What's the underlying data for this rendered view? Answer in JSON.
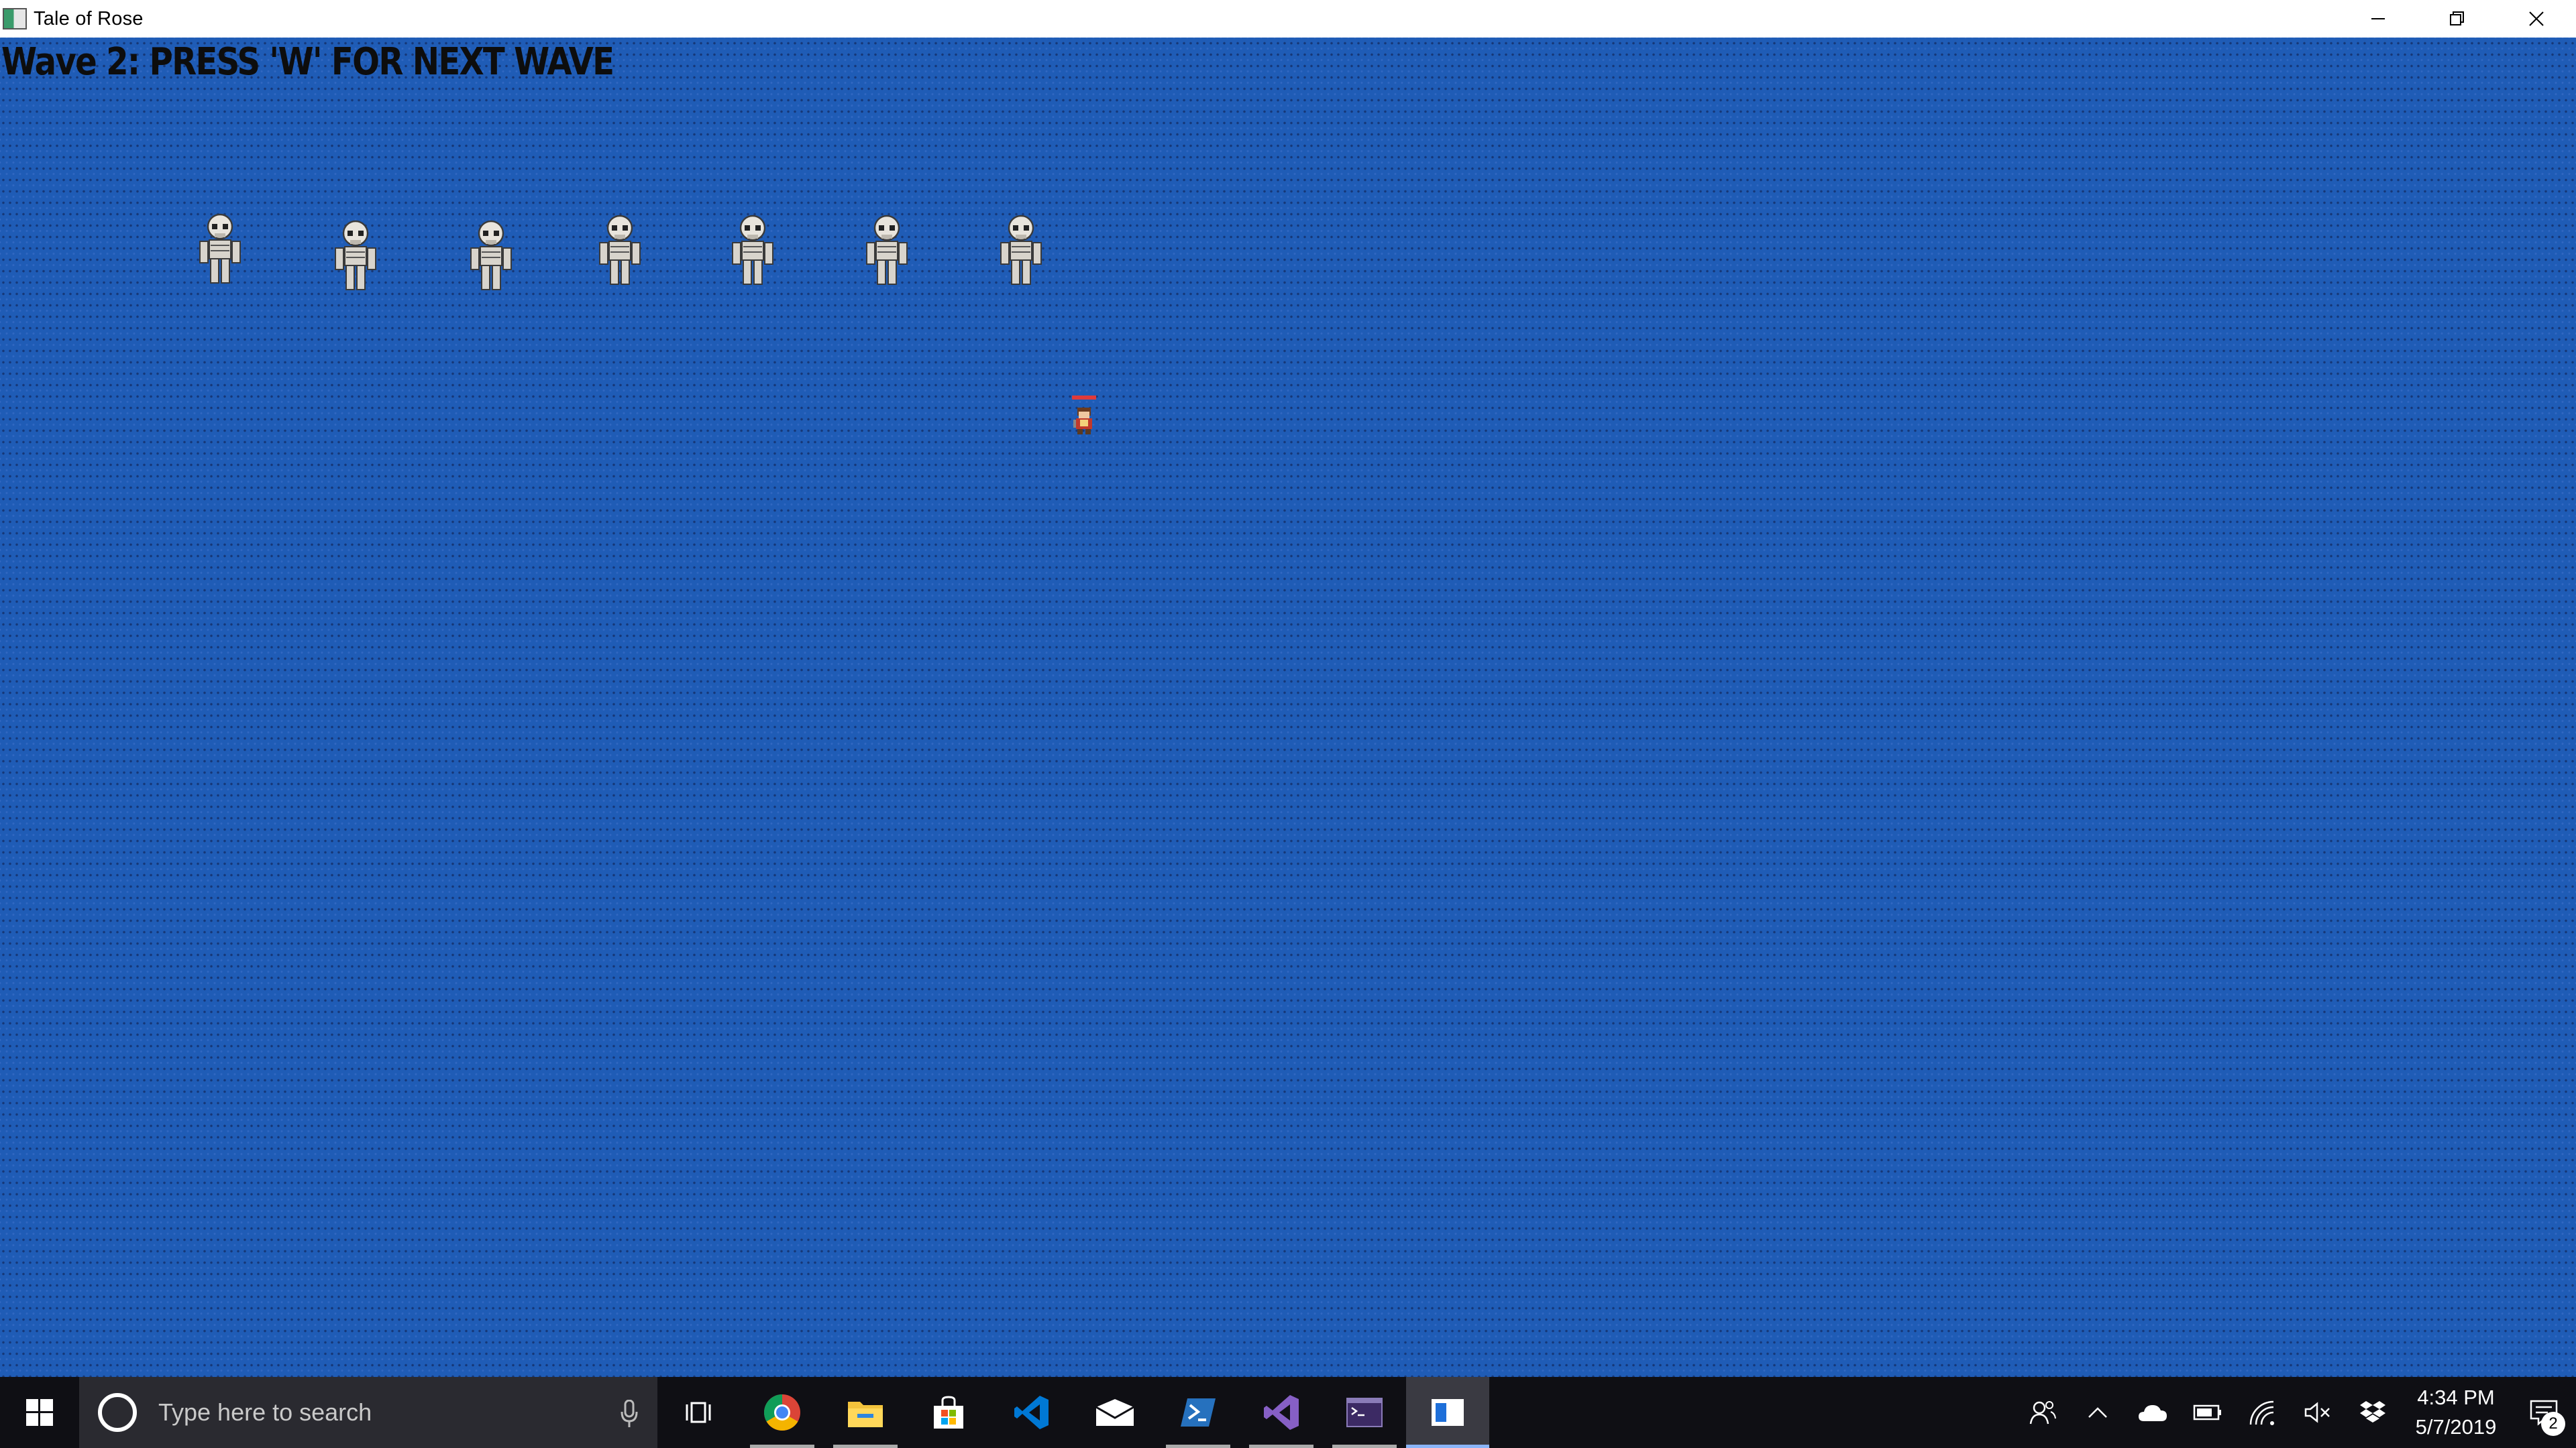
{
  "window": {
    "title": "Tale of Rose"
  },
  "game": {
    "wave_text": "Wave 2: PRESS 'W' FOR NEXT WAVE",
    "enemies": [
      {
        "kind": "skeleton"
      },
      {
        "kind": "skeleton"
      },
      {
        "kind": "skeleton"
      },
      {
        "kind": "skeleton"
      },
      {
        "kind": "skeleton"
      },
      {
        "kind": "skeleton"
      },
      {
        "kind": "skeleton"
      }
    ],
    "player": {
      "kind": "hero-sprite"
    },
    "background_color": "#1f5cb6"
  },
  "taskbar": {
    "search_placeholder": "Type here to search",
    "apps": [
      {
        "name": "task-view-icon"
      },
      {
        "name": "chrome-icon"
      },
      {
        "name": "file-explorer-icon"
      },
      {
        "name": "store-icon"
      },
      {
        "name": "vscode-icon"
      },
      {
        "name": "mail-icon"
      },
      {
        "name": "powershell-icon"
      },
      {
        "name": "visual-studio-icon"
      },
      {
        "name": "terminal-icon"
      },
      {
        "name": "tale-of-rose-app-icon"
      }
    ],
    "time": "4:34 PM",
    "date": "5/7/2019",
    "notification_count": "2"
  }
}
